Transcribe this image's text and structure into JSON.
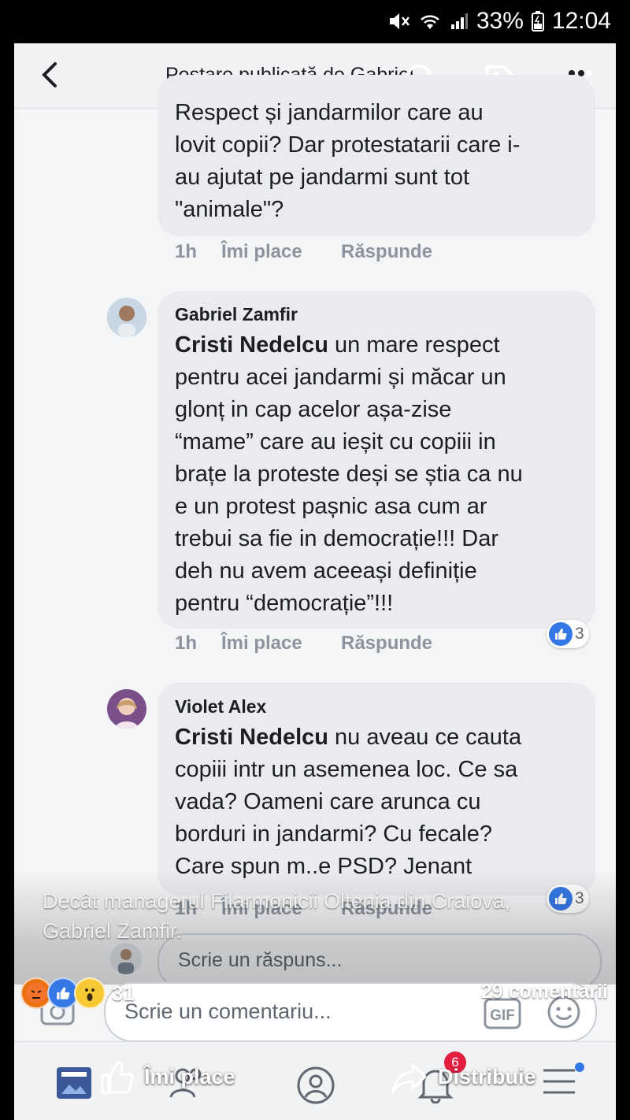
{
  "status_bar": {
    "battery": "33%",
    "time": "12:04"
  },
  "header": {
    "title": "Postare publicată de Gabriel"
  },
  "comments": [
    {
      "name": "",
      "lines": [
        "Respect și jandarmilor care au",
        "lovit copii? Dar protestatarii care i-",
        "au ajutat pe jandarmi sunt tot",
        "\"animale\"?"
      ],
      "time": "1h",
      "like_label": "Îmi place",
      "reply_label": "Răspunde"
    },
    {
      "name": "Gabriel Zamfir",
      "mention": "Cristi Nedelcu",
      "first_rest": " un mare respect",
      "lines": [
        "pentru acei jandarmi și măcar un",
        "glonț in cap acelor așa-zise",
        "“mame” care au ieșit cu copiii in",
        "brațe la proteste deși se știa ca nu",
        "e un protest pașnic asa cum ar",
        "trebui sa fie in democrație!!! Dar",
        "deh nu avem aceeași definiție",
        "pentru “democrație”!!!"
      ],
      "time": "1h",
      "like_label": "Îmi place",
      "reply_label": "Răspunde",
      "reaction_count": "3"
    },
    {
      "name": "Violet Alex",
      "mention": "Cristi Nedelcu",
      "first_rest": " nu aveau ce cauta",
      "lines": [
        "copiii intr un asemenea loc. Ce sa",
        "vada? Oameni care arunca cu",
        "borduri in jandarmi? Cu fecale?",
        "Care spun m..e PSD? Jenant"
      ],
      "time": "1h",
      "like_label": "Îmi place",
      "reply_label": "Răspunde",
      "reaction_count": "3"
    }
  ],
  "reply_placeholder": "Scrie un răspuns...",
  "caption": {
    "line1": "Decât managerul Filarmonicii Oltenia din Craiova,",
    "line2": "Gabriel Zamfir."
  },
  "post_reactions": {
    "count": "31"
  },
  "comment_count": "29 comentarii",
  "comment_placeholder": "Scrie un comentariu...",
  "gif_label": "GIF",
  "actions": {
    "like": "Îmi place",
    "share": "Distribuie"
  },
  "notifications_count": "6"
}
